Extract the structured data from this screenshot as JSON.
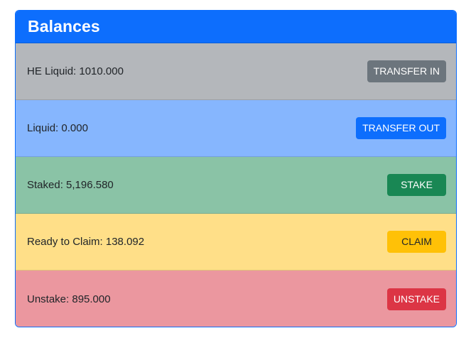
{
  "card": {
    "title": "Balances"
  },
  "rows": [
    {
      "label": "HE Liquid: 1010.000",
      "button": "TRANSFER IN"
    },
    {
      "label": "Liquid: 0.000",
      "button": "TRANSFER OUT"
    },
    {
      "label": "Staked: 5,196.580",
      "button": "STAKE"
    },
    {
      "label": "Ready to Claim: 138.092",
      "button": "CLAIM"
    },
    {
      "label": "Unstake: 895.000",
      "button": "UNSTAKE"
    }
  ],
  "colors": {
    "header": "#0d6efd",
    "secondary": "#6c757d",
    "primary": "#0d6efd",
    "success": "#198754",
    "warning": "#ffc107",
    "danger": "#dc3545"
  }
}
